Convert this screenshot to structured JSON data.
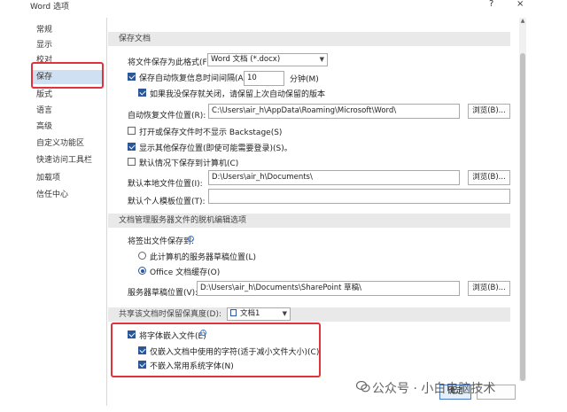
{
  "window": {
    "title": "Word 选项",
    "help_glyph": "?",
    "close_glyph": "×"
  },
  "sidebar": {
    "items": [
      {
        "label": "常规"
      },
      {
        "label": "显示"
      },
      {
        "label": "校对"
      },
      {
        "label": "保存",
        "selected": true
      },
      {
        "label": "版式"
      },
      {
        "label": "语言"
      },
      {
        "label": "高级"
      },
      {
        "label": "自定义功能区"
      },
      {
        "label": "快速访问工具栏"
      },
      {
        "label": "加载项"
      },
      {
        "label": "信任中心"
      }
    ]
  },
  "save_docs": {
    "header": "保存文档",
    "format_label": "将文件保存为此格式(F):",
    "format_value": "Word 文档 (*.docx)",
    "autorecover_label": "保存自动恢复信息时间间隔(A)",
    "autorecover_checked": true,
    "autorecover_minutes": "10",
    "minutes_label": "分钟(M)",
    "keep_last_label": "如果我没保存就关闭，请保留上次自动保留的版本",
    "keep_last_checked": true,
    "autorecover_path_label": "自动恢复文件位置(R):",
    "autorecover_path": "C:\\Users\\air_h\\AppData\\Roaming\\Microsoft\\Word\\",
    "browse_label": "浏览(B)...",
    "no_backstage_label": "打开或保存文件时不显示 Backstage(S)",
    "no_backstage_checked": false,
    "show_more_label": "显示其他保存位置(即使可能需要登录)(S)。",
    "show_more_checked": true,
    "default_computer_label": "默认情况下保存到计算机(C)",
    "default_computer_checked": false,
    "local_path_label": "默认本地文件位置(I):",
    "local_path": "D:\\Users\\air_h\\Documents\\",
    "browse2_label": "浏览(B)...",
    "template_label": "默认个人模板位置(T):",
    "template_path": ""
  },
  "offline": {
    "header": "文档管理服务器文件的脱机编辑选项",
    "checkout_label": "将签出文件保存到:",
    "opt1_label": "此计算机的服务器草稿位置(L)",
    "opt1_selected": false,
    "opt2_label": "Office 文档缓存(O)",
    "opt2_selected": true,
    "server_label": "服务器草稿位置(V):",
    "server_path": "D:\\Users\\air_h\\Documents\\SharePoint 草稿\\",
    "browse3_label": "浏览(B)..."
  },
  "fidelity": {
    "header": "共享该文档时保留保真度(D):",
    "doc_value": "文档1",
    "embed_label": "将字体嵌入文件(E)",
    "embed_checked": true,
    "embed_used_label": "仅嵌入文档中使用的字符(适于减小文件大小)(C)",
    "embed_used_checked": true,
    "no_common_label": "不嵌入常用系统字体(N)",
    "no_common_checked": true
  },
  "footer": {
    "ok_label": "确定"
  },
  "watermark": {
    "text": "公众号 · 小白电脑技术"
  },
  "colors": {
    "accent": "#2b579a",
    "highlight": "#e0343c",
    "selected_nav": "#cfe0f3"
  }
}
